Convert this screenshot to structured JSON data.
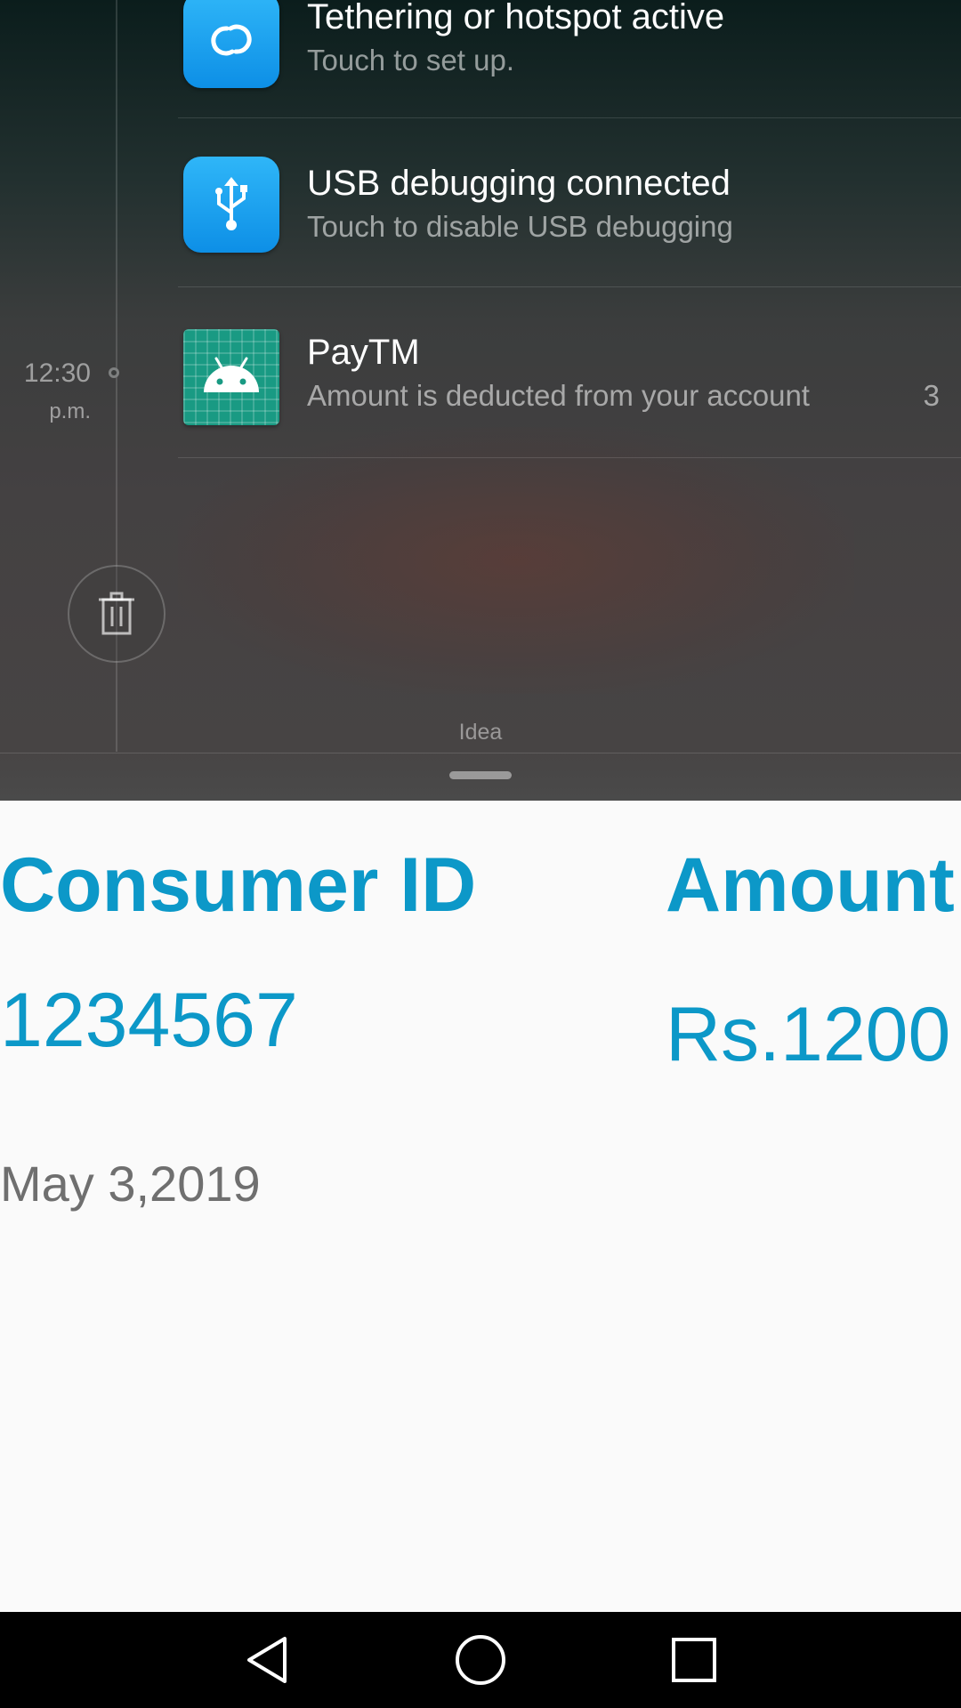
{
  "notifications": [
    {
      "title": "Tethering or hotspot active",
      "text": "Touch to set up.",
      "icon": "hotspot-icon"
    },
    {
      "title": "USB debugging connected",
      "text": "Touch to disable USB debugging",
      "icon": "usb-icon"
    },
    {
      "title": "PayTM",
      "text": "Amount is deducted from your account",
      "count": "3",
      "icon": "android-app-icon"
    }
  ],
  "timeline": {
    "time": "12:30",
    "ampm": "p.m."
  },
  "clear_button": {
    "icon": "trash-icon"
  },
  "carrier": "Idea",
  "app": {
    "consumer_label": "Consumer ID",
    "amount_label": "Amount",
    "consumer_id": "1234567",
    "amount": "Rs.1200",
    "date": "May 3,2019"
  },
  "navbar": {
    "back_icon": "back-icon",
    "home_icon": "home-icon",
    "recents_icon": "recents-icon"
  },
  "colors": {
    "accent": "#0c98c8",
    "date_text": "#6f6f6f",
    "notification_icon_blue": "#1ba3ef",
    "android_icon_green": "#199a83"
  }
}
